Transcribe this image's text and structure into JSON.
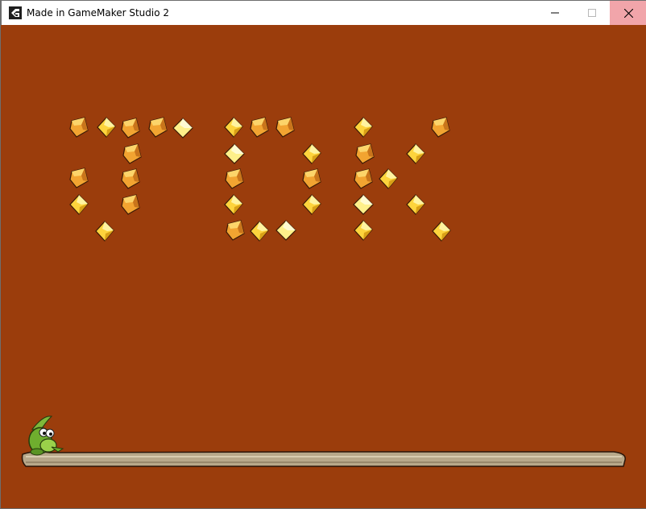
{
  "window": {
    "title": "Made in GameMaker Studio 2",
    "app_icon": "gamemaker-icon",
    "controls": [
      "minimize-icon",
      "maximize-icon",
      "close-icon"
    ],
    "close_hover_color": "#f1a5aa"
  },
  "game": {
    "background_color": "#9b3d0c",
    "gem_colors": {
      "orange": "#f2a431",
      "gold": "#fdd43d",
      "pale": "#fef08a"
    },
    "player": "green-frog-sprite",
    "ground": "log-platform"
  }
}
